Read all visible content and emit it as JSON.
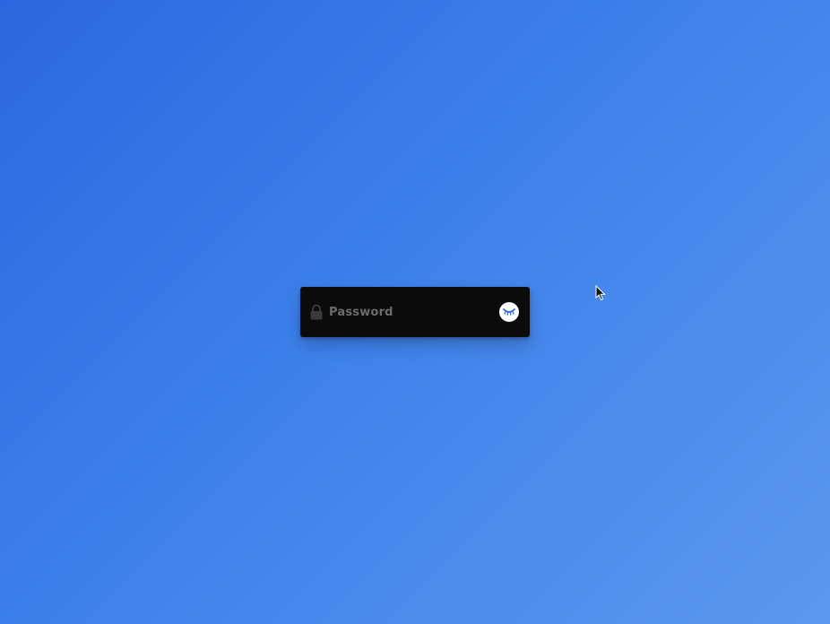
{
  "password_field": {
    "placeholder": "Password",
    "value": "",
    "lock_icon": "lock-icon",
    "toggle_icon": "eye-closed-icon"
  },
  "colors": {
    "background_start": "#2b67e0",
    "background_end": "#5b98ef",
    "field_background": "#0b0b0c",
    "placeholder": "#6c6c6c",
    "toggle_background": "#ffffff",
    "toggle_lashes": "#2f6fe0"
  },
  "cursor": {
    "icon": "pointer-cursor-icon"
  }
}
